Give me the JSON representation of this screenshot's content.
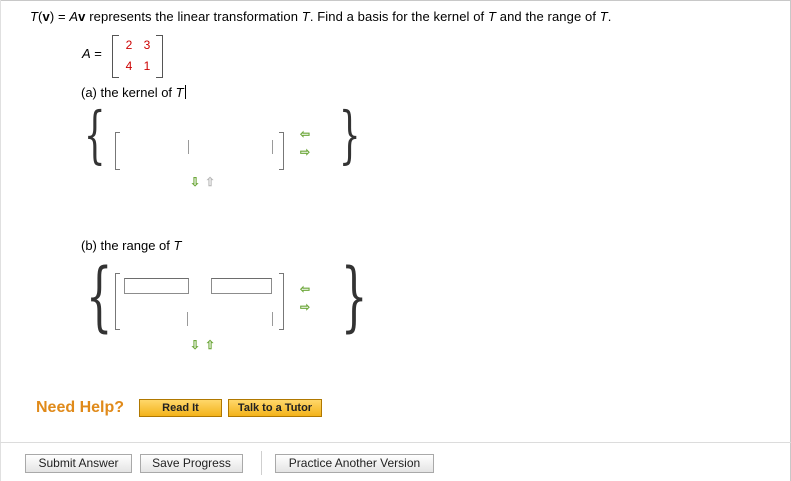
{
  "question": {
    "t": "T",
    "v_open": "(",
    "v": "v",
    "v_close": ")",
    "eq": " = ",
    "a": "A",
    "av_v": "v",
    "text1": " represents the linear transformation ",
    "text2": ". Find a basis for the kernel of ",
    "text3": " and the range of ",
    "text4": "."
  },
  "matrix": {
    "label": "A",
    "eq": " =",
    "cells": [
      [
        "2",
        "3"
      ],
      [
        "4",
        "1"
      ]
    ]
  },
  "part_a": {
    "label_prefix": "(a) the kernel of ",
    "label_var": "T",
    "input_values": [
      "",
      ""
    ]
  },
  "part_b": {
    "label_prefix": "(b) the range of ",
    "label_var": "T",
    "input_values": [
      "",
      "",
      "",
      ""
    ]
  },
  "glyphs": {
    "brace_open": "{",
    "brace_close": "}",
    "arrow_left": "⇦",
    "arrow_right": "⇨",
    "arrow_down": "⇩",
    "arrow_up": "⇧"
  },
  "colors": {
    "matrix_entry": "#cc0000",
    "help_label": "#e08a1a",
    "arrow_active": "#6ea83c",
    "arrow_inactive": "#b8b8b8"
  },
  "help": {
    "label": "Need Help?",
    "read_it": "Read It",
    "talk_tutor": "Talk to a Tutor"
  },
  "footer": {
    "submit": "Submit Answer",
    "save": "Save Progress",
    "practice": "Practice Another Version"
  }
}
